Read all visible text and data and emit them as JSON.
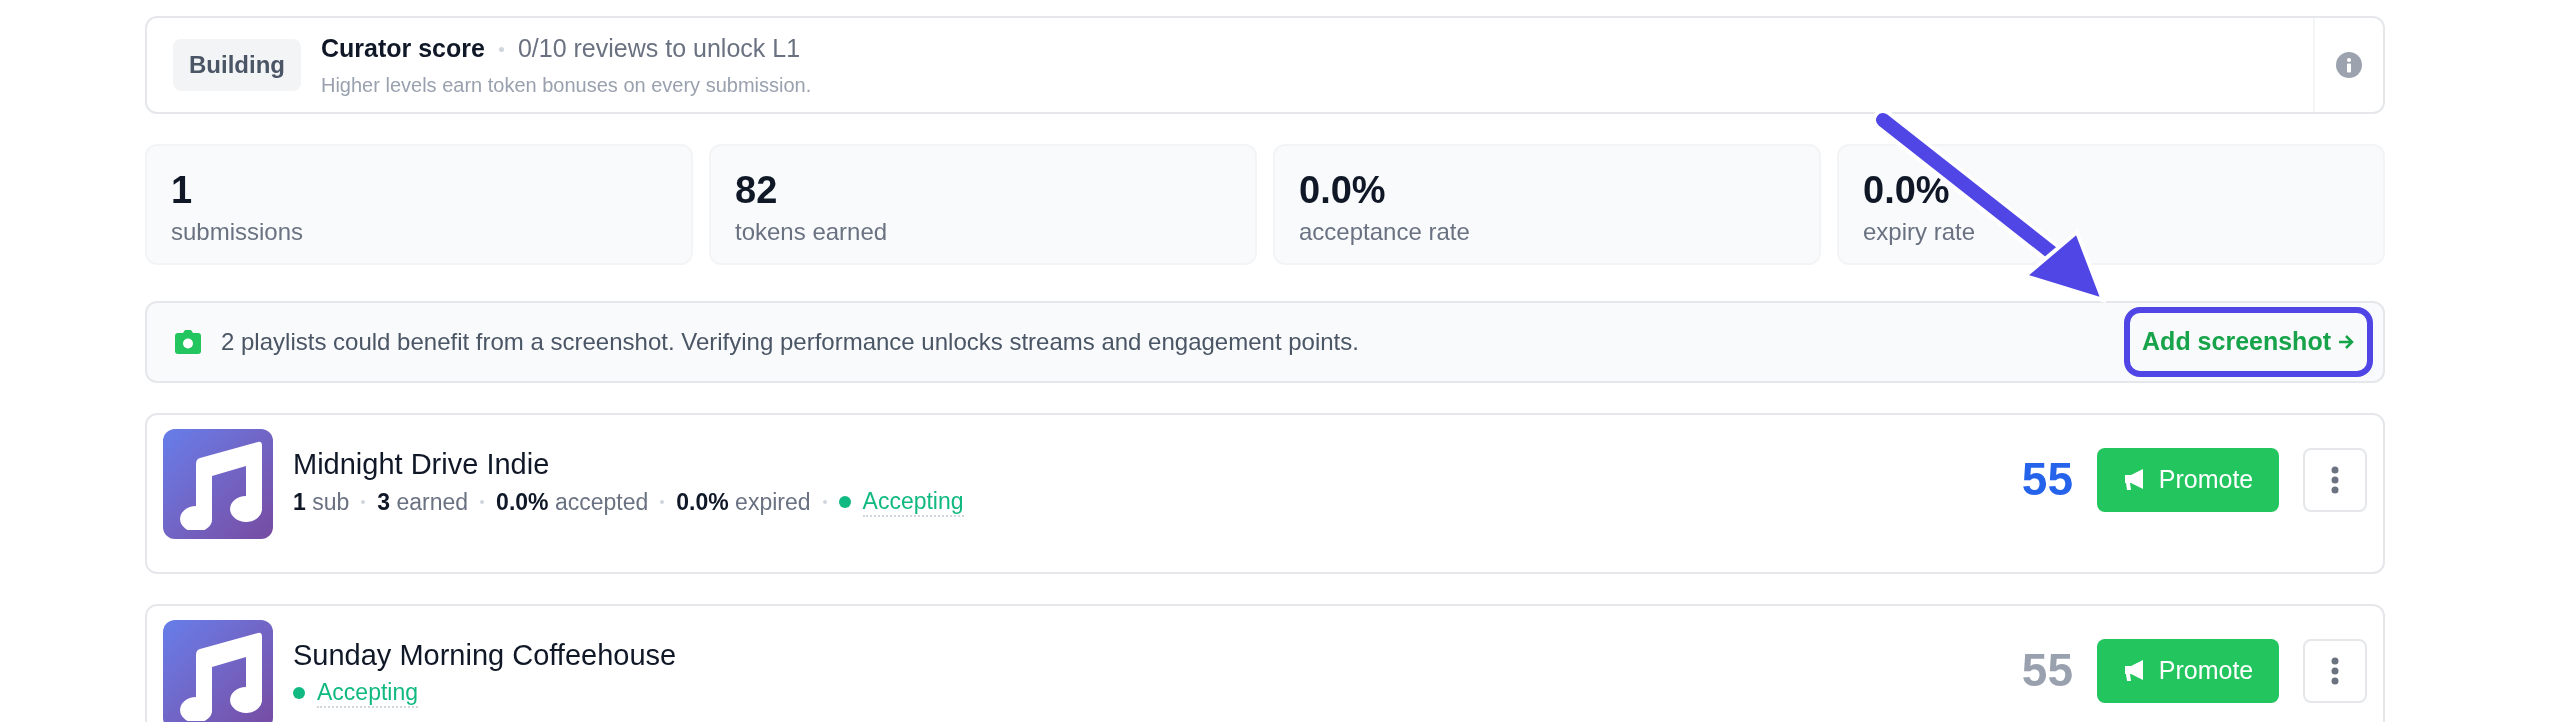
{
  "curator": {
    "badge": "Building",
    "title": "Curator score",
    "progress": "0/10 reviews to unlock L1",
    "subtitle": "Higher levels earn token bonuses on every submission."
  },
  "stats": [
    {
      "value": "1",
      "label": "submissions"
    },
    {
      "value": "82",
      "label": "tokens earned"
    },
    {
      "value": "0.0%",
      "label": "acceptance rate"
    },
    {
      "value": "0.0%",
      "label": "expiry rate"
    }
  ],
  "banner": {
    "text": "2 playlists could benefit from a screenshot. Verifying performance unlocks streams and engagement points.",
    "link": "Add screenshot",
    "highlighted": true
  },
  "playlists": [
    {
      "name": "Midnight Drive Indie",
      "meta": [
        "**1** sub",
        "**3** earned",
        "**0.0%** accepted",
        "**0.0%** expired"
      ],
      "status": "Accepting",
      "score": "55",
      "score_active": true,
      "button": "Promote"
    },
    {
      "name": "Sunday Morning Coffeehouse",
      "status": "Accepting",
      "score": "55",
      "score_active": false,
      "button": "Promote"
    }
  ]
}
